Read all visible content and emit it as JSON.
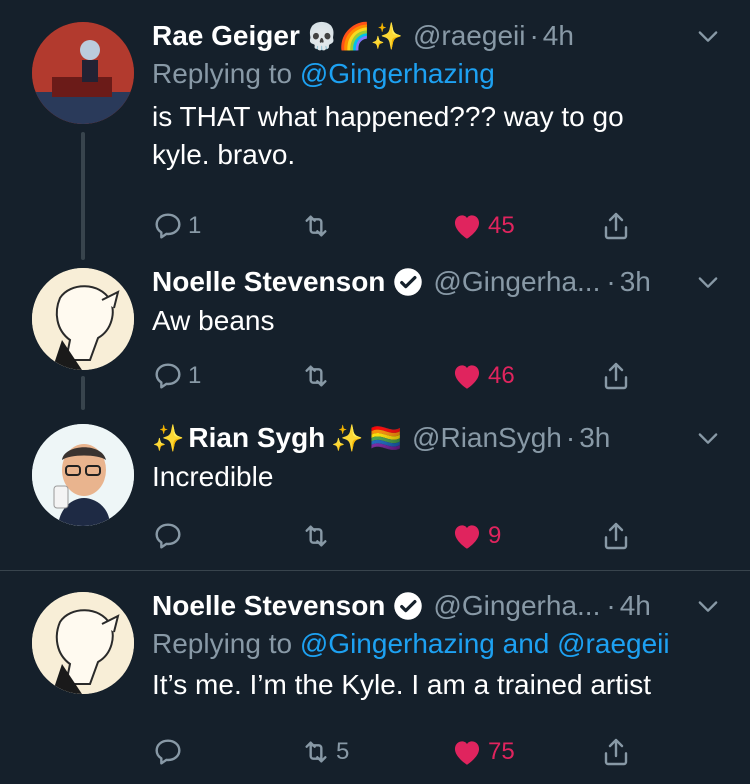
{
  "tweets": [
    {
      "name": "Rae Geiger",
      "emojis": "💀🌈✨",
      "handle": "@raegeii",
      "time": "4h",
      "replying_prefix": "Replying to ",
      "replying_to": "@Gingerhazing",
      "text": "is THAT what happened??? way to go kyle. bravo.",
      "replies": "1",
      "retweets": "",
      "likes": "45",
      "liked": true
    },
    {
      "name": "Noelle Stevenson",
      "verified": true,
      "handle": "@Gingerha...",
      "time": "3h",
      "text": "Aw beans",
      "replies": "1",
      "retweets": "",
      "likes": "46",
      "liked": true
    },
    {
      "name_prefix_emoji": "✨",
      "name": "Rian Sygh",
      "name_suffix_emoji": "✨",
      "flag": "🏳️‍🌈",
      "handle": "@RianSygh",
      "time": "3h",
      "text": "Incredible",
      "replies": "",
      "retweets": "",
      "likes": "9",
      "liked": true
    },
    {
      "name": "Noelle Stevenson",
      "verified": true,
      "handle": "@Gingerha...",
      "time": "4h",
      "replying_prefix": "Replying to ",
      "replying_to": "@Gingerhazing and @raegeii",
      "text": "It’s me. I’m the Kyle. I am a trained artist",
      "replies": "",
      "retweets": "5",
      "likes": "75",
      "liked": true
    }
  ],
  "colors": {
    "bg": "#15202b",
    "like": "#e0245e",
    "link": "#1da1f2",
    "muted": "#8899a6"
  },
  "icons": [
    "reply-icon",
    "retweet-icon",
    "like-icon",
    "share-icon",
    "chevron-down-icon",
    "verified-icon"
  ]
}
